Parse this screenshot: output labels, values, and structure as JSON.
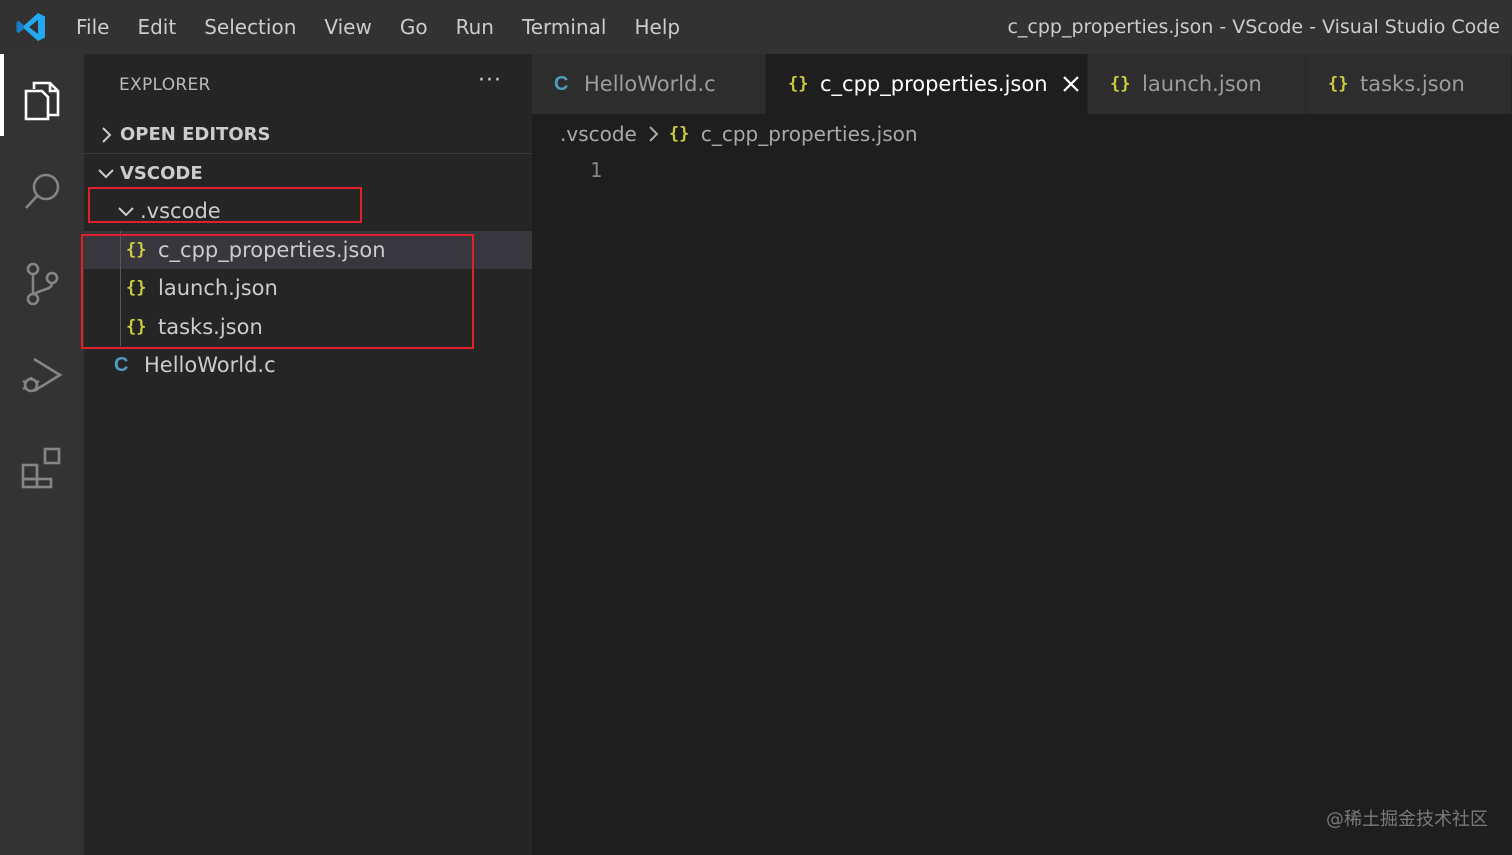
{
  "titlebar": {
    "menu": [
      "File",
      "Edit",
      "Selection",
      "View",
      "Go",
      "Run",
      "Terminal",
      "Help"
    ],
    "window_title": "c_cpp_properties.json - VScode - Visual Studio Code"
  },
  "activitybar": {
    "icons": [
      "files-icon",
      "search-icon",
      "source-control-icon",
      "run-debug-icon",
      "extensions-icon"
    ]
  },
  "sidebar": {
    "title": "EXPLORER",
    "more": "···",
    "open_editors_label": "OPEN EDITORS",
    "workspace_label": "VSCODE",
    "folder": ".vscode",
    "folder_files": [
      "c_cpp_properties.json",
      "launch.json",
      "tasks.json"
    ],
    "root_file": "HelloWorld.c",
    "json_icon_glyph": "{}",
    "c_icon_glyph": "C"
  },
  "tabs": [
    {
      "label": "HelloWorld.c",
      "icon": "C",
      "active": false
    },
    {
      "label": "c_cpp_properties.json",
      "icon": "{}",
      "active": true
    },
    {
      "label": "launch.json",
      "icon": "{}",
      "active": false
    },
    {
      "label": "tasks.json",
      "icon": "{}",
      "active": false
    }
  ],
  "breadcrumb": {
    "folder": ".vscode",
    "file": "c_cpp_properties.json"
  },
  "editor": {
    "line_numbers": [
      "1"
    ]
  },
  "watermark": "@稀土掘金技术社区",
  "colors": {
    "json_icon": "#cbcb41",
    "c_icon": "#519aba",
    "highlight_box": "#e0202a",
    "logo": "#23a9f2"
  }
}
